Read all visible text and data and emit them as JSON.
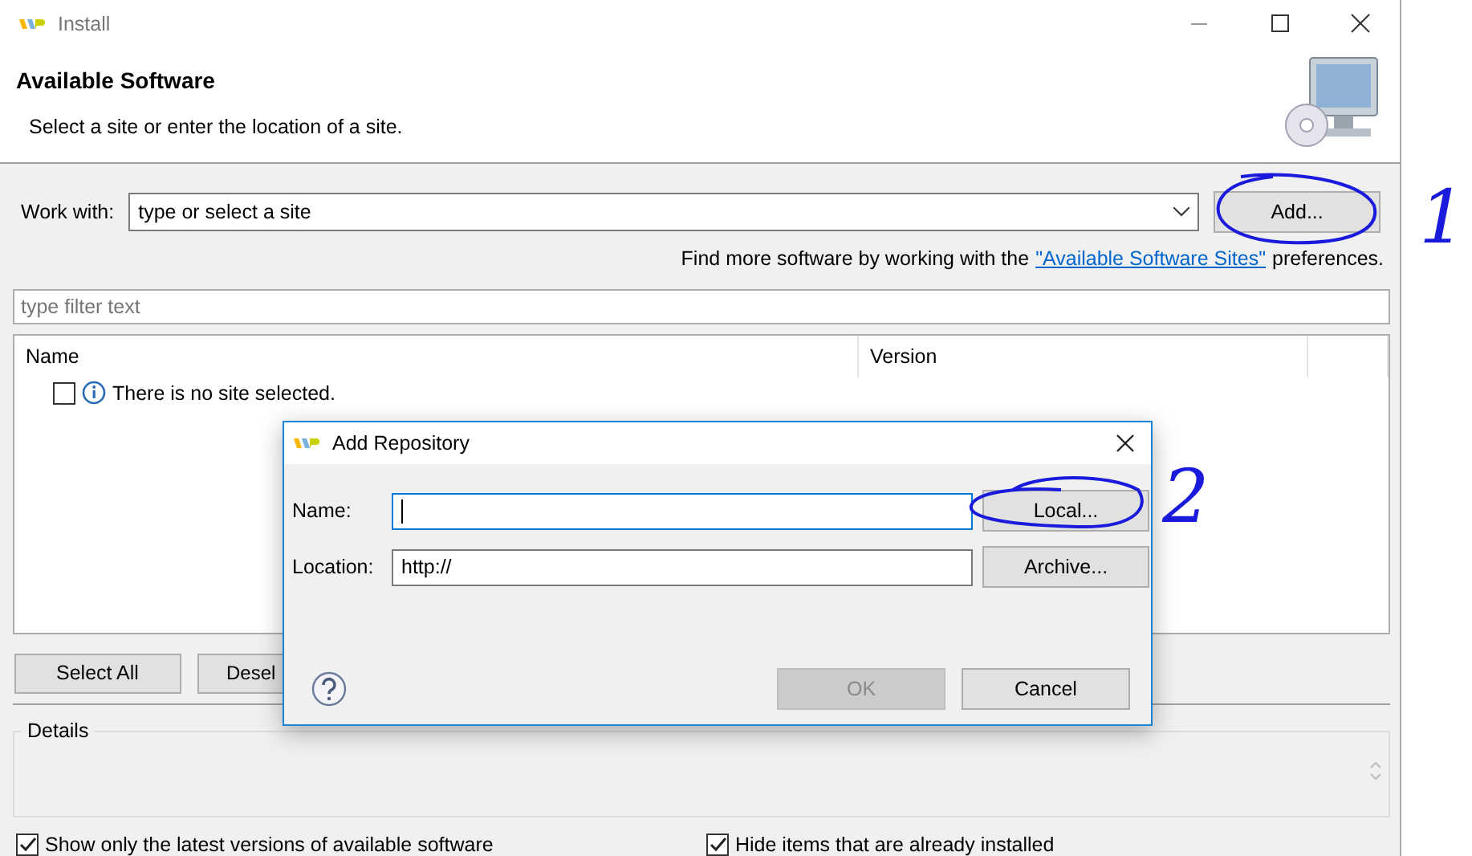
{
  "window": {
    "title": "Install"
  },
  "header": {
    "title": "Available Software",
    "subtitle": "Select a site or enter the location of a site."
  },
  "work_with": {
    "label": "Work with:",
    "placeholder": "type or select a site",
    "add_button": "Add..."
  },
  "more_software": {
    "prefix": "Find more software by working with the",
    "link": "\"Available Software Sites\"",
    "suffix": "preferences."
  },
  "filter": {
    "placeholder": "type filter text"
  },
  "table": {
    "columns": [
      "Name",
      "Version"
    ],
    "rows": [
      {
        "text": "There is no site selected.",
        "checked": false
      }
    ]
  },
  "buttons": [
    {
      "label": "Select All",
      "disabled": false
    },
    {
      "label": "Desel",
      "disabled": false
    }
  ],
  "details": {
    "label": "Details"
  },
  "options": [
    {
      "label": "Show only the latest versions of available software",
      "checked": true
    },
    {
      "label": "Hide items that are already installed",
      "checked": true
    }
  ],
  "dialog": {
    "title": "Add Repository",
    "fields": [
      {
        "label": "Name:",
        "focused": true,
        "button": "Local..."
      },
      {
        "label": "Location:",
        "value": "http://",
        "focused": false,
        "button": "Archive..."
      }
    ],
    "buttons": [
      {
        "label": "OK",
        "disabled": true
      },
      {
        "label": "Cancel",
        "disabled": false
      }
    ]
  },
  "annotations": [
    {
      "text": "1"
    },
    {
      "text": "2"
    }
  ]
}
